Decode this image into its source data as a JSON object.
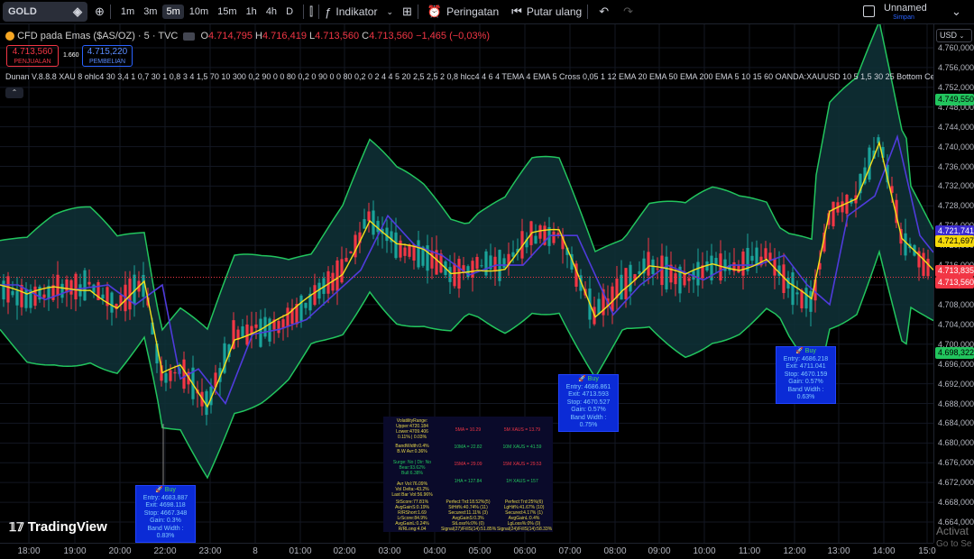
{
  "toolbar": {
    "symbol": "GOLD",
    "timeframes": [
      "1m",
      "3m",
      "5m",
      "10m",
      "15m",
      "1h",
      "4h",
      "D"
    ],
    "active_timeframe": "5m",
    "indicator_label": "Indikator",
    "alert_label": "Peringatan",
    "replay_label": "Putar ulang",
    "layout_name": "Unnamed",
    "layout_status": "Simpan"
  },
  "legend": {
    "title": "CFD pada Emas ($AS/OZ) · 5 · TVC",
    "O": "4.714,795",
    "H": "4.716,419",
    "L": "4.713,560",
    "C": "4.713,560",
    "change": "−1,465 (−0,03%)"
  },
  "prices": {
    "sell": "4.713,560",
    "sell_label": "PENJUALAN",
    "spread": "1.660",
    "buy": "4.715,220",
    "buy_label": "PEMBELIAN"
  },
  "indicator_line": "Dunan V.8.8.8 XAU 8 ohlc4 30 3,4 1 0,7 30 1 0,8 3 4 1,5 70 10 300 0,2 90 0 0 80 0,2 0 90 0 0 80 0,2 0 2 4 4 5 20 2,5 2,5 2 0,8 hlcc4 4 6 4 TEMA 4 EMA 5 Cross 0,05 1 12 EMA 20 EMA 50 EMA 200 EMA 5 10 15 60 OANDA:XAUUSD 10 5 1,5 30 25 Bottom Center",
  "axis": {
    "currency": "USD",
    "y_ticks": [
      "4.760,000",
      "4.756,000",
      "4.752,000",
      "4.748,000",
      "4.744,000",
      "4.740,000",
      "4.736,000",
      "4.732,000",
      "4.728,000",
      "4.724,000",
      "4.720,000",
      "4.716,000",
      "4.712,000",
      "4.708,000",
      "4.704,000",
      "4.700,000",
      "4.696,000",
      "4.692,000",
      "4.688,000",
      "4.684,000",
      "4.680,000",
      "4.676,000",
      "4.672,000",
      "4.668,000",
      "4.664,000"
    ],
    "x_ticks": [
      "18:00",
      "19:00",
      "20:00",
      "22:00",
      "23:00",
      "8",
      "01:00",
      "02:00",
      "03:00",
      "04:00",
      "05:00",
      "06:00",
      "07:00",
      "08:00",
      "09:00",
      "10:00",
      "11:00",
      "12:00",
      "13:00",
      "14:00",
      "15:0"
    ],
    "price_tags": [
      {
        "value": "4.749,550",
        "color": "#22c55e",
        "text": "#000"
      },
      {
        "value": "4.721,741",
        "color": "#3b2bd0",
        "text": "#fff"
      },
      {
        "value": "4.721,697",
        "color": "#f5d90a",
        "text": "#000"
      },
      {
        "value": "4.713,835",
        "color": "#f23645",
        "text": "#fff"
      },
      {
        "value": "4.713,560",
        "color": "#f23645",
        "text": "#fff"
      },
      {
        "value": "4.698,322",
        "color": "#22c55e",
        "text": "#000"
      }
    ]
  },
  "signals": [
    {
      "title": "Buy",
      "entry": "Entry: 4683.887",
      "exit": "Exit: 4698.118",
      "stop": "Stop: 4667.348",
      "gain": "Gain: 0.3%",
      "bw": "Band Width : 0.83%"
    },
    {
      "title": "Buy",
      "entry": "Entry: 4686.861",
      "exit": "Exit: 4713.593",
      "stop": "Stop: 4670.527",
      "gain": "Gain: 0.57%",
      "bw": "Band Width : 0.75%"
    },
    {
      "title": "Buy",
      "entry": "Entry: 4686.218",
      "exit": "Exit: 4711.041",
      "stop": "Stop: 4670.159",
      "gain": "Gain: 0.57%",
      "bw": "Band Width : 0.63%"
    }
  ],
  "stats": {
    "volatility": [
      "VolatilityRange:",
      "Upper:4720.184",
      "Lower:4709.406",
      "0.11% | 0.03%"
    ],
    "bandwidth": [
      "BandWidth:0.4%",
      "B.W Avr:0.36%"
    ],
    "surge": [
      "Surge: No | Dir: No",
      "Bear:93.62%",
      "Bull:6.38%"
    ],
    "vol": [
      "Avr Vol:76.09%",
      "Vol Delta:-43.2%",
      "Last Bar Vol:56.96%"
    ],
    "score": [
      "StScore:77.81%",
      "AvgGainS:0.19%",
      "R/RShort:1.69",
      "LrScore:84.9%",
      "AvgGainL:0.24%",
      "R/RLong:4.04"
    ],
    "ma": [
      "5MA = 10.29",
      "5M XAUS = 13.79",
      "10MA = 22.82",
      "10M XAUS = 41.59",
      "15MA = 29.09",
      "15M XAUS = 29.53",
      "1HA = 127.84",
      "1H XAUS = 157"
    ],
    "perf1": [
      "Perfect:Trd:18.52%(5)",
      "StHit%:40.74% (11)",
      "Secured:11.11% (3)",
      "AvgGainS:0.3%",
      "StLoss%:0% (0)",
      "Signal(27)/FillS(14):51.85%"
    ],
    "perf2": [
      "Perfect:Trd:25%(6)",
      "LgHit%:41.67% (10)",
      "Secured:4.17% (1)",
      "AvgGainL:0.4%",
      "LgLoss%:0% (0)",
      "Signal(24)/FillS(14):58.33%"
    ]
  },
  "brand": "TradingView",
  "watermark": "Activat",
  "watermark2": "Go to Se"
}
